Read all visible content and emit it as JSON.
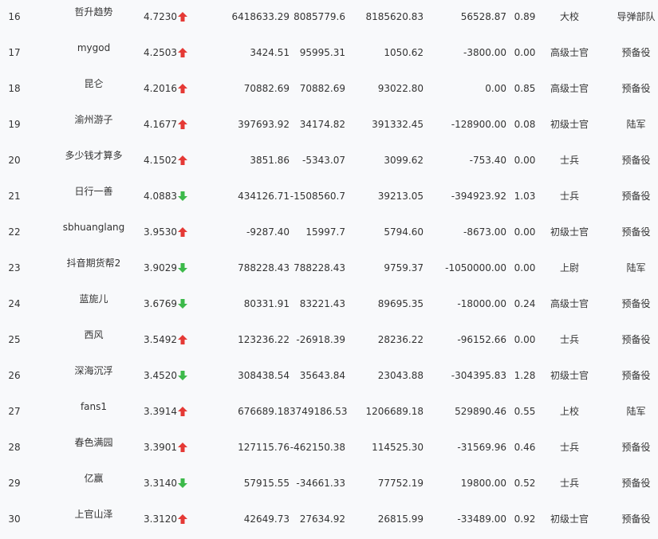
{
  "rows": [
    {
      "rank": "16",
      "name": "哲升趋势",
      "score": "4.7230",
      "trend": "up",
      "v1": "6418633.29",
      "v2": "8085779.6",
      "v3": "8185620.83",
      "v4": "56528.87",
      "v5": "0.89",
      "title": "大校",
      "unit": "导弹部队"
    },
    {
      "rank": "17",
      "name": "mygod",
      "score": "4.2503",
      "trend": "up",
      "v1": "3424.51",
      "v2": "95995.31",
      "v3": "1050.62",
      "v4": "-3800.00",
      "v5": "0.00",
      "title": "高级士官",
      "unit": "预备役"
    },
    {
      "rank": "18",
      "name": "昆仑",
      "score": "4.2016",
      "trend": "up",
      "v1": "70882.69",
      "v2": "70882.69",
      "v3": "93022.80",
      "v4": "0.00",
      "v5": "0.85",
      "title": "高级士官",
      "unit": "预备役"
    },
    {
      "rank": "19",
      "name": "渝州游子",
      "score": "4.1677",
      "trend": "up",
      "v1": "397693.92",
      "v2": "34174.82",
      "v3": "391332.45",
      "v4": "-128900.00",
      "v5": "0.08",
      "title": "初级士官",
      "unit": "陆军"
    },
    {
      "rank": "20",
      "name": "多少钱才算多",
      "score": "4.1502",
      "trend": "up",
      "v1": "3851.86",
      "v2": "-5343.07",
      "v3": "3099.62",
      "v4": "-753.40",
      "v5": "0.00",
      "title": "士兵",
      "unit": "预备役"
    },
    {
      "rank": "21",
      "name": "日行一善",
      "score": "4.0883",
      "trend": "down",
      "v1": "434126.71",
      "v2": "-1508560.7",
      "v3": "39213.05",
      "v4": "-394923.92",
      "v5": "1.03",
      "title": "士兵",
      "unit": "预备役"
    },
    {
      "rank": "22",
      "name": "sbhuanglang",
      "score": "3.9530",
      "trend": "up",
      "v1": "-9287.40",
      "v2": "15997.7",
      "v3": "5794.60",
      "v4": "-8673.00",
      "v5": "0.00",
      "title": "初级士官",
      "unit": "预备役"
    },
    {
      "rank": "23",
      "name": "抖音期货帮2",
      "score": "3.9029",
      "trend": "down",
      "v1": "788228.43",
      "v2": "788228.43",
      "v3": "9759.37",
      "v4": "-1050000.00",
      "v5": "0.00",
      "title": "上尉",
      "unit": "陆军"
    },
    {
      "rank": "24",
      "name": "蓝旎儿",
      "score": "3.6769",
      "trend": "down",
      "v1": "80331.91",
      "v2": "83221.43",
      "v3": "89695.35",
      "v4": "-18000.00",
      "v5": "0.24",
      "title": "高级士官",
      "unit": "预备役"
    },
    {
      "rank": "25",
      "name": "西风",
      "score": "3.5492",
      "trend": "up",
      "v1": "123236.22",
      "v2": "-26918.39",
      "v3": "28236.22",
      "v4": "-96152.66",
      "v5": "0.00",
      "title": "士兵",
      "unit": "预备役"
    },
    {
      "rank": "26",
      "name": "深海沉浮",
      "score": "3.4520",
      "trend": "down",
      "v1": "308438.54",
      "v2": "35643.84",
      "v3": "23043.88",
      "v4": "-304395.83",
      "v5": "1.28",
      "title": "初级士官",
      "unit": "预备役"
    },
    {
      "rank": "27",
      "name": "fans1",
      "score": "3.3914",
      "trend": "up",
      "v1": "676689.18",
      "v2": "3749186.53",
      "v3": "1206689.18",
      "v4": "529890.46",
      "v5": "0.55",
      "title": "上校",
      "unit": "陆军"
    },
    {
      "rank": "28",
      "name": "春色满园",
      "score": "3.3901",
      "trend": "up",
      "v1": "127115.76",
      "v2": "-462150.38",
      "v3": "114525.30",
      "v4": "-31569.96",
      "v5": "0.46",
      "title": "士兵",
      "unit": "预备役"
    },
    {
      "rank": "29",
      "name": "亿赢",
      "score": "3.3140",
      "trend": "down",
      "v1": "57915.55",
      "v2": "-34661.33",
      "v3": "77752.19",
      "v4": "19800.00",
      "v5": "0.52",
      "title": "士兵",
      "unit": "预备役"
    },
    {
      "rank": "30",
      "name": "上官山泽",
      "score": "3.3120",
      "trend": "up",
      "v1": "42649.73",
      "v2": "27634.92",
      "v3": "26815.99",
      "v4": "-33489.00",
      "v5": "0.92",
      "title": "初级士官",
      "unit": "预备役"
    }
  ],
  "icons": {
    "up": "arrow-up-icon",
    "down": "arrow-down-icon"
  },
  "colors": {
    "up": "#e53935",
    "down": "#3cb94a"
  }
}
